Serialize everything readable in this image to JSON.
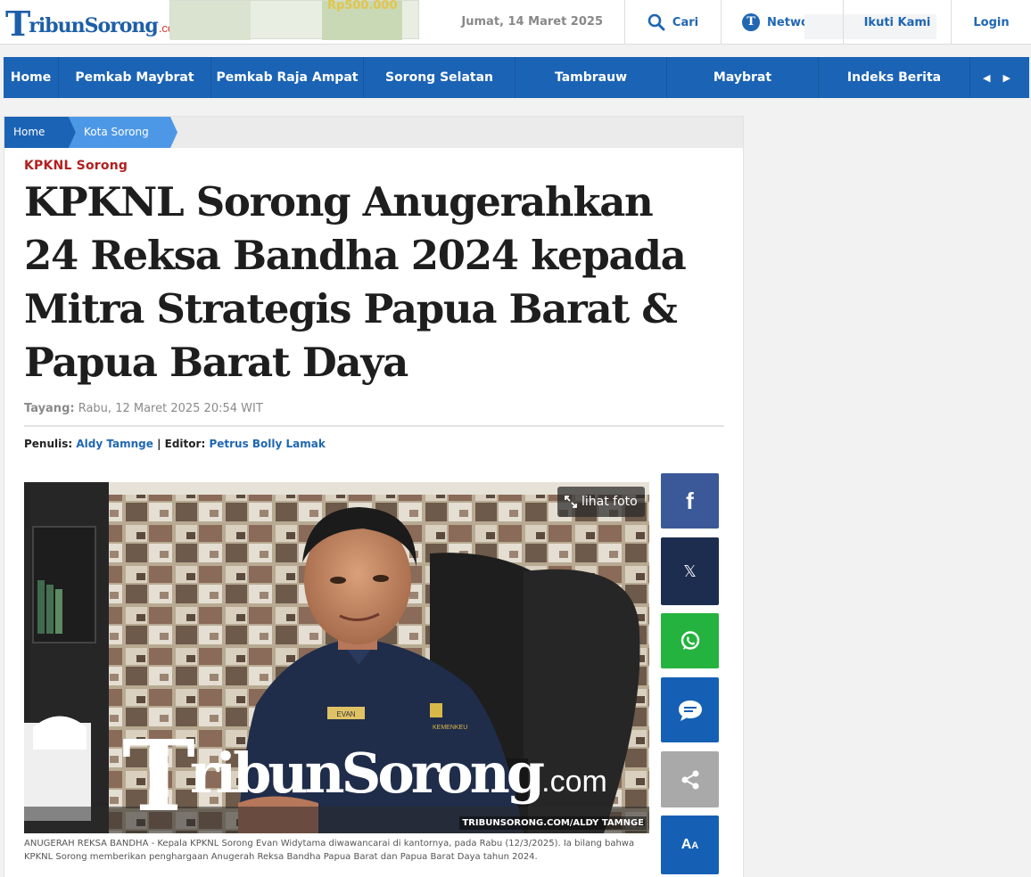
{
  "header": {
    "logo_letter": "T",
    "logo_text": "ribunSorong",
    "logo_suffix": ".com",
    "ad_text": "Rp500.000",
    "date": "Jumat, 14 Maret 2025",
    "search_label": "Cari",
    "network_label": "Network",
    "network_badge": "T",
    "follow_label": "Ikuti Kami",
    "login_label": "Login"
  },
  "nav": {
    "items": [
      "Home",
      "Pemkab Maybrat",
      "Pemkab Raja Ampat",
      "Sorong Selatan",
      "Tambrauw",
      "Maybrat",
      "Indeks Berita"
    ],
    "prev": "◀",
    "next": "▶"
  },
  "breadcrumb": {
    "home": "Home",
    "category": "Kota Sorong"
  },
  "article": {
    "kicker": "KPKNL Sorong",
    "title": "KPKNL Sorong Anugerahkan 24 Reksa Bandha 2024 kepada Mitra Strategis Papua Barat & Papua Barat Daya",
    "published_label": "Tayang:",
    "published_value": "Rabu, 12 Maret 2025 20:54 WIT",
    "writer_label": "Penulis:",
    "writer": "Aldy Tamnge",
    "editor_label": "Editor:",
    "editor": "Petrus Bolly Lamak",
    "view_photo": "lihat foto",
    "watermark_letter": "T",
    "watermark_text": "ribunSorong",
    "watermark_suffix": ".com",
    "photo_credit": "TRIBUNSORONG.COM/ALDY TAMNGE",
    "name_tag": "EVAN",
    "shirt_logo": "KEMENKEU",
    "caption": "ANUGERAH REKSA BANDHA - Kepala KPKNL Sorong Evan Widytama diwawancarai di kantornya, pada Rabu (12/3/2025). Ia bilang bahwa KPKNL Sorong memberikan penghargaan Anugerah Reksa Bandha Papua Barat dan Papua Barat Daya tahun 2024."
  },
  "share": {
    "facebook_glyph": "f",
    "x_glyph": "𝕏",
    "font_glyph_big": "A",
    "font_glyph_small": "A",
    "colors": {
      "facebook": "#3b5998",
      "x": "#1c2d4f",
      "whatsapp": "#25b33f",
      "comment": "#1560b4",
      "share": "#a9a9a9",
      "font": "#1560b4"
    }
  },
  "colors": {
    "brand_blue": "#1b63b5",
    "kicker_red": "#b2201e"
  }
}
